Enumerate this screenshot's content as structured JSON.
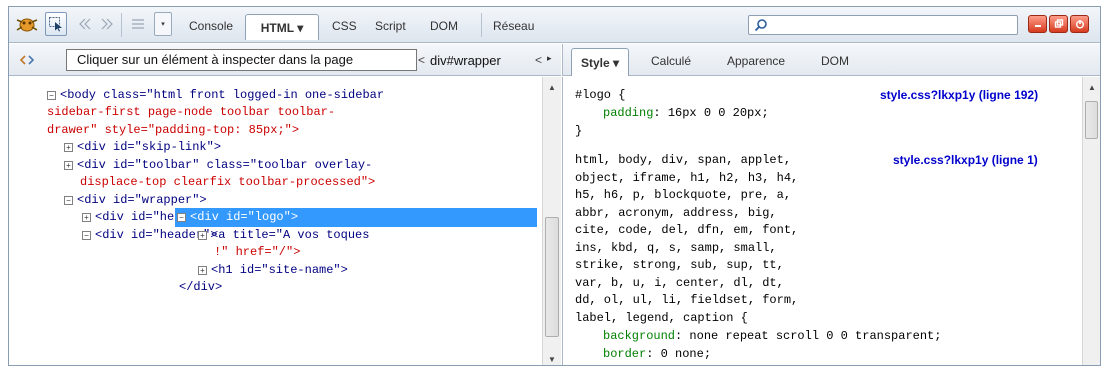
{
  "toolbar": {
    "back_icon": "double-chevron-left",
    "forward_icon": "double-chevron-right",
    "menu_arrow": "▾",
    "tabs": [
      "Console",
      "HTML ▾",
      "CSS",
      "Script",
      "DOM",
      "Réseau"
    ],
    "search_value": ""
  },
  "subbar": {
    "tooltip": "Cliquer sur un élément à inspecter dans la page",
    "breadcrumb_prev": "<",
    "breadcrumb_item": "div#wrapper",
    "breadcrumb_next": "<",
    "breadcrumb_more": "▸"
  },
  "side_tabs": [
    "Style ▾",
    "Calculé",
    "Apparence",
    "DOM"
  ],
  "tree": {
    "body_line1": "<body class=\"html front logged-in one-sidebar",
    "body_line2": "sidebar-first page-node toolbar toolbar-",
    "body_line3": "drawer\" style=\"padding-top: 85px;\">",
    "skip_link": "<div id=\"skip-link\">",
    "toolbar_line1": "<div id=\"toolbar\" class=\"toolbar overlay-",
    "toolbar_line2": "displace-top clearfix toolbar-processed\">",
    "wrapper": "<div id=\"wrapper\">",
    "header_top": "<div id=\"header-top\">",
    "header": "<div id=\"header\">",
    "logo": "<div id=\"logo\">",
    "a_line1": "<a title=\"A vos toques",
    "a_line2": "!\" href=\"/\">",
    "h1": "<h1 id=\"site-name\">",
    "close_div": "</div>"
  },
  "style": {
    "rule1_selector": "#logo {",
    "rule1_prop": "padding",
    "rule1_value": ": 16px 0 0 20px;",
    "rule1_close": "}",
    "rule1_source": "style.css?lkxp1y (ligne 192)",
    "rule2_selectors": [
      "html, body, div, span, applet,",
      "object, iframe, h1, h2, h3, h4,",
      "h5, h6, p, blockquote, pre, a,",
      "abbr, acronym, address, big,",
      "cite, code, del, dfn, em, font,",
      "ins, kbd, q, s, samp, small,",
      "strike, strong, sub, sup, tt,",
      "var, b, u, i, center, dl, dt,",
      "dd, ol, ul, li, fieldset, form,",
      "label, legend, caption {"
    ],
    "rule2_source": "style.css?lkxp1y (ligne 1)",
    "rule2_prop1": "background",
    "rule2_value1": ": none repeat scroll 0 0 transparent;",
    "rule2_prop2": "border",
    "rule2_value2": ": 0 none;"
  }
}
